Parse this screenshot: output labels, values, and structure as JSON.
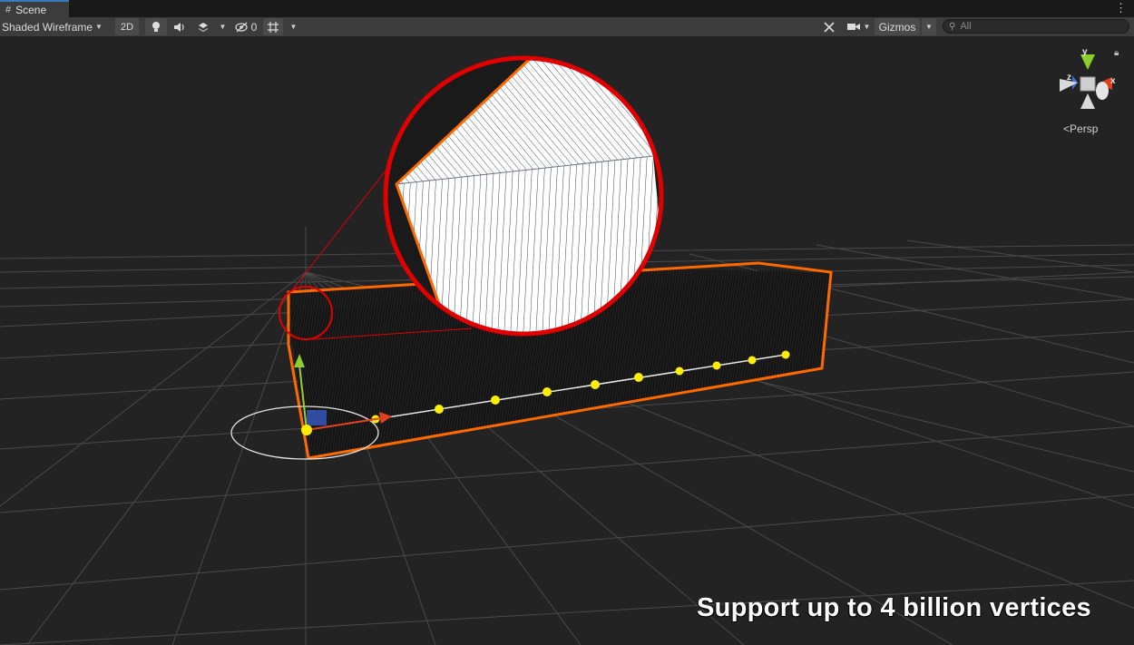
{
  "tab": {
    "title": "Scene"
  },
  "toolbar": {
    "draw_mode": "Shaded Wireframe",
    "mode_2d": "2D",
    "hidden_count": "0",
    "gizmos_label": "Gizmos",
    "search_placeholder": "All"
  },
  "scene_gizmo": {
    "projection": "Persp",
    "y_axis": "y",
    "x_axis": "x",
    "z_axis": "z"
  },
  "caption": "Support up to 4 billion vertices",
  "colors": {
    "selection_outline": "#ff6a00",
    "highlight_circle": "#e10000",
    "spline_points": "#ffee00",
    "tab_accent": "#3a79bb"
  }
}
